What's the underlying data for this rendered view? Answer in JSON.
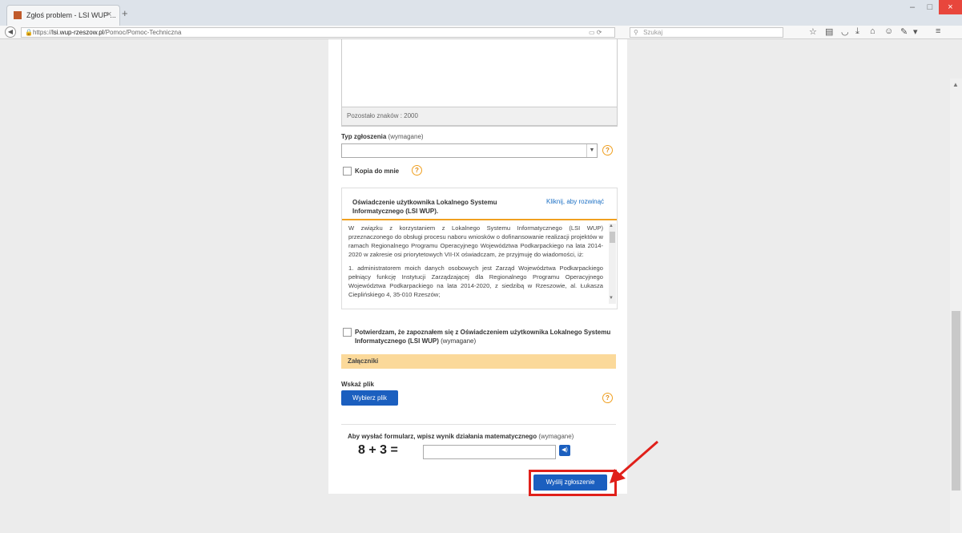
{
  "browser": {
    "tab_title": "Zgłoś problem - LSI WUP ...",
    "tab_close": "×",
    "new_tab": "+",
    "url_prefix": "https://",
    "url_host": "lsi.wup-rzeszow.pl",
    "url_path": "/Pomoc/Pomoc-Techniczna",
    "search_placeholder": "Szukaj",
    "reader_icon": "reader-view-icon",
    "toolbar_icons": [
      "star-icon",
      "library-icon",
      "pocket-icon",
      "download-icon",
      "home-icon",
      "sync-icon",
      "extension-icon",
      "menu-icon"
    ],
    "window_controls": [
      "minimize-icon",
      "maximize-icon",
      "close-icon"
    ],
    "window_close_color": "#e8463c",
    "tab_strip_color": "#dde3ea"
  },
  "form": {
    "remaining_label": "Pozostało znaków : 2000",
    "type_label": "Typ zgłoszenia",
    "type_required": "(wymagane)",
    "type_value": "",
    "copy_label": "Kopia do mnie",
    "declaration_title": "Oświadczenie użytkownika Lokalnego Systemu Informatycznego (LSI WUP).",
    "declaration_expand": "Kliknij, aby rozwinąć",
    "declaration_p1": "W związku z korzystaniem z Lokalnego Systemu Informatycznego (LSI WUP) przeznaczonego do obsługi procesu naboru wniosków o dofinansowanie realizacji projektów w ramach Regionalnego Programu Operacyjnego Województwa Podkarpackiego na lata 2014-2020 w zakresie osi priorytetowych VII-IX oświadczam, że przyjmuję do wiadomości, iż:",
    "declaration_p2": "1. administratorem moich danych osobowych jest Zarząd Województwa Podkarpackiego pełniący funkcję Instytucji Zarządzającej dla Regionalnego Programu Operacyjnego Województwa Podkarpackiego na lata 2014-2020, z siedzibą w Rzeszowie, al. Łukasza Cieplińskiego 4, 35-010 Rzeszów;",
    "confirm_bold": "Potwierdzam, że zapoznałem się z Oświadczeniem użytkownika Lokalnego Systemu Informatycznego (LSI WUP)",
    "confirm_required": "(wymagane)",
    "attachments_header": "Załączniki",
    "file_label": "Wskaż plik",
    "file_button": "Wybierz plik",
    "captcha_label": "Aby wysłać formularz, wpisz wynik działania matematycznego",
    "captcha_required": "(wymagane)",
    "captcha_equation": "8 + 3 =",
    "captcha_value": "",
    "submit_button": "Wyślij zgłoszenie",
    "accent_color": "#f0a020",
    "button_color": "#1b5fbf",
    "highlight_color": "#e0201a"
  }
}
